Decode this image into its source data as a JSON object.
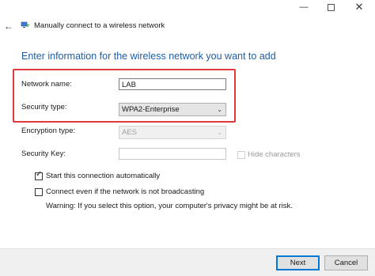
{
  "window": {
    "title": "Manually connect to a wireless network",
    "minimize_icon": "minimize-icon",
    "maximize_icon": "maximize-icon",
    "close_icon": "close-icon",
    "back_icon": "back-arrow-icon",
    "app_icon": "network-icon"
  },
  "heading": "Enter information for the wireless network you want to add",
  "form": {
    "network_name_label": "Network name:",
    "network_name_value": "LAB",
    "security_type_label": "Security type:",
    "security_type_value": "WPA2-Enterprise",
    "encryption_type_label": "Encryption type:",
    "encryption_type_value": "AES",
    "security_key_label": "Security Key:",
    "security_key_value": "",
    "hide_characters_label": "Hide characters"
  },
  "options": {
    "start_auto_label": "Start this connection automatically",
    "start_auto_checked": true,
    "connect_hidden_label": "Connect even if the network is not broadcasting",
    "connect_hidden_checked": false,
    "warning": "Warning: If you select this option, your computer's privacy might be at risk."
  },
  "buttons": {
    "next": "Next",
    "cancel": "Cancel"
  },
  "colors": {
    "heading": "#1e5ea8",
    "highlight_box": "#e0393e",
    "primary_border": "#0078d7"
  }
}
